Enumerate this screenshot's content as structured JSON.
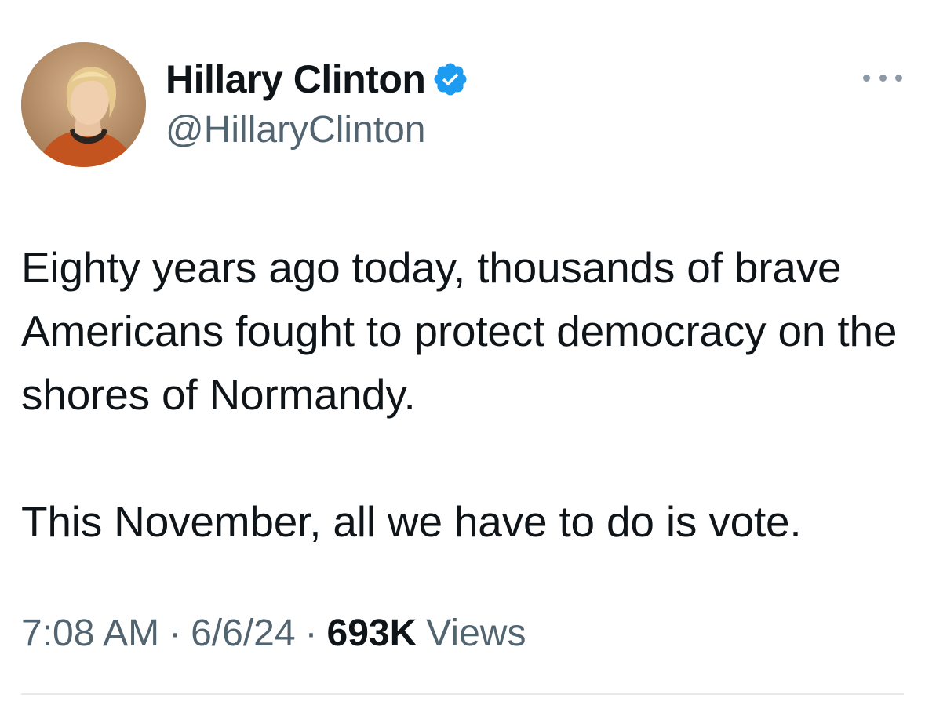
{
  "author": {
    "display_name": "Hillary Clinton",
    "handle": "@HillaryClinton",
    "verified": true,
    "verified_badge_icon": "verified-badge-icon",
    "avatar_icon": "profile-photo"
  },
  "tweet": {
    "paragraphs": [
      "Eighty years ago today, thousands of brave Americans fought to protect democracy on the shores of Normandy.",
      "This November, all we have to do is vote."
    ]
  },
  "meta": {
    "time": "7:08 AM",
    "separator": "·",
    "date": "6/6/24",
    "views_count": "693K",
    "views_label": "Views"
  },
  "actions": {
    "more_icon": "more-options-icon"
  },
  "colors": {
    "primary_text": "#0f1419",
    "secondary_text": "#536471",
    "verified_blue": "#1d9bf0",
    "divider": "#e7e9ea"
  }
}
